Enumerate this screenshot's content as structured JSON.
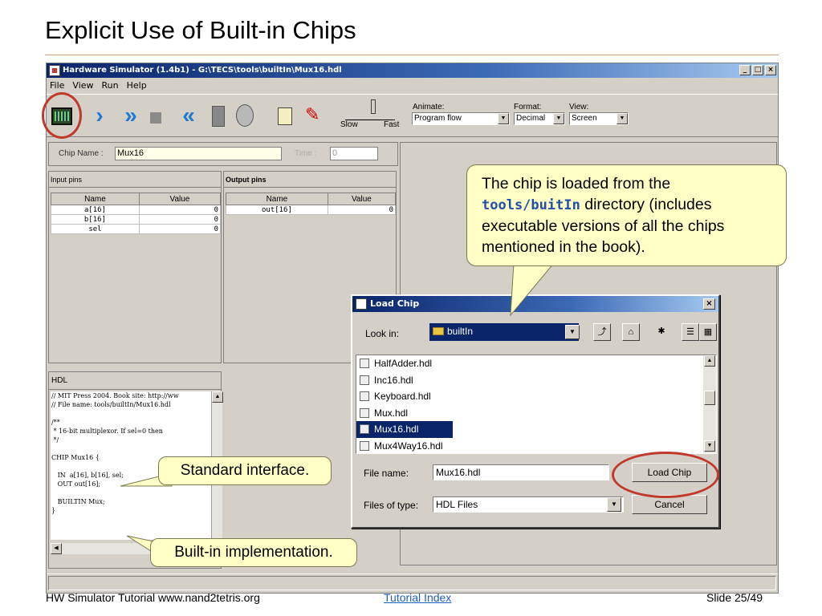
{
  "slide": {
    "title": "Explicit Use of Built-in Chips",
    "footer_left": "HW Simulator Tutorial www.nand2tetris.org",
    "footer_link": "Tutorial Index",
    "footer_right": "Slide 25/49"
  },
  "window": {
    "title": "Hardware Simulator (1.4b1) - G:\\TECS\\tools\\builtIn\\Mux16.hdl",
    "btn_min": "_",
    "btn_max": "□",
    "btn_close": "×"
  },
  "menu": [
    "File",
    "View",
    "Run",
    "Help"
  ],
  "toolbar": {
    "slow_label": "Slow",
    "fast_label": "Fast",
    "animate_label": "Animate:",
    "animate_value": "Program flow",
    "format_label": "Format:",
    "format_value": "Decimal",
    "view_label": "View:",
    "view_value": "Screen"
  },
  "chip": {
    "name_label": "Chip Name :",
    "name_value": "Mux16",
    "time_label": "Time :",
    "time_value": "0"
  },
  "input_pins": {
    "title": "Input pins",
    "col_name": "Name",
    "col_value": "Value",
    "rows": [
      {
        "name": "a[16]",
        "value": "0"
      },
      {
        "name": "b[16]",
        "value": "0"
      },
      {
        "name": "sel",
        "value": "0"
      }
    ]
  },
  "output_pins": {
    "title": "Output pins",
    "col_name": "Name",
    "col_value": "Value",
    "rows": [
      {
        "name": "out[16]",
        "value": "0"
      }
    ]
  },
  "hdl": {
    "title": "HDL",
    "lines": [
      "// MIT Press 2004. Book site: http://ww",
      "// File name: tools/builtIn/Mux16.hdl",
      "",
      "/**",
      " * 16-bit multiplexor. If sel=0 then",
      " */",
      "",
      "CHIP Mux16 {",
      "",
      "   IN  a[16], b[16], sel;",
      "   OUT out[16];",
      "",
      "   BUILTIN Mux;",
      "}"
    ]
  },
  "dialog": {
    "title": "Load Chip",
    "close": "×",
    "look_in_label": "Look in:",
    "look_in_value": "builtIn",
    "files": [
      "HalfAdder.hdl",
      "Inc16.hdl",
      "Keyboard.hdl",
      "Mux.hdl",
      "Mux16.hdl",
      "Mux4Way16.hdl"
    ],
    "selected_file": "Mux16.hdl",
    "file_name_label": "File name:",
    "file_name_value": "Mux16.hdl",
    "files_type_label": "Files of type:",
    "files_type_value": "HDL Files",
    "load_button": "Load Chip",
    "cancel_button": "Cancel"
  },
  "callouts": {
    "big_line1": "The chip is loaded from the",
    "big_code": "tools/buitIn",
    "big_rest1": " directory (includes",
    "big_line3": "executable versions of all the chips",
    "big_line4": "mentioned in the book).",
    "standard": "Standard interface.",
    "builtin": "Built-in implementation."
  },
  "colors": {
    "accent_blue": "#1f78d1",
    "highlight_red": "#c0392b",
    "callout_fill": "#ffffc6",
    "selection": "#0a246a"
  }
}
